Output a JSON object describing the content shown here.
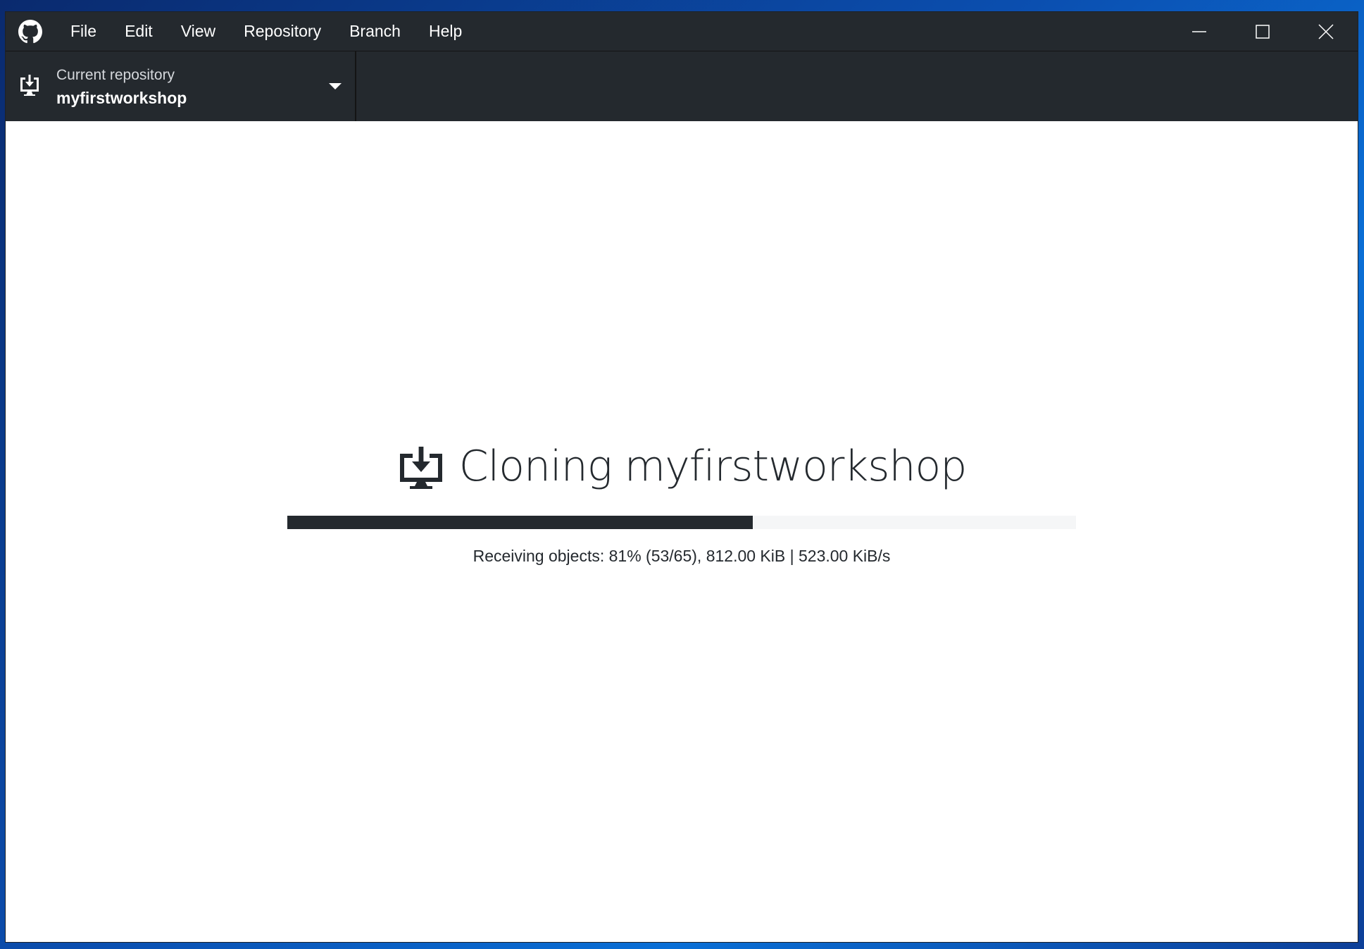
{
  "menu": {
    "items": [
      {
        "label": "File"
      },
      {
        "label": "Edit"
      },
      {
        "label": "View"
      },
      {
        "label": "Repository"
      },
      {
        "label": "Branch"
      },
      {
        "label": "Help"
      }
    ]
  },
  "toolbar": {
    "repo_label": "Current repository",
    "repo_name": "myfirstworkshop"
  },
  "clone": {
    "title": "Cloning myfirstworkshop",
    "progress_fraction": 0.59,
    "status": "Receiving objects: 81% (53/65), 812.00 KiB | 523.00 KiB/s"
  },
  "colors": {
    "chrome": "#24292e",
    "progress_track": "#f5f6f7",
    "background": "#ffffff"
  },
  "icons": [
    "github-logo-icon",
    "minimize-icon",
    "maximize-icon",
    "close-icon",
    "clone-download-icon",
    "chevron-down-icon"
  ]
}
